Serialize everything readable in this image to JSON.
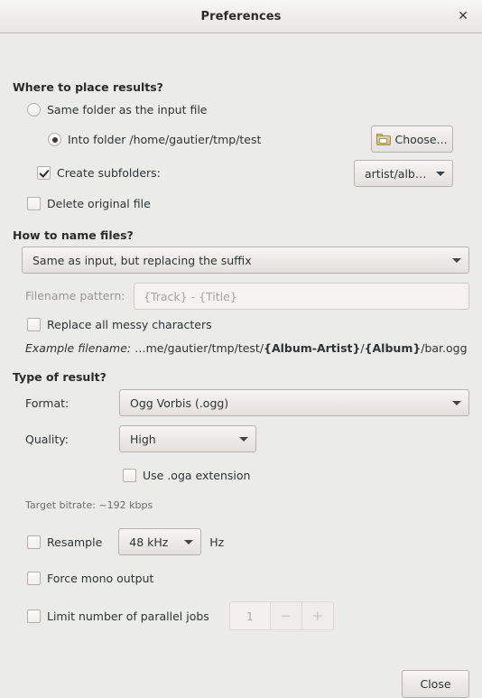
{
  "window": {
    "title": "Preferences",
    "close_icon": "close-icon",
    "close_label": "✕"
  },
  "sections": {
    "where": {
      "heading": "Where to place results?",
      "radio_same_folder": {
        "label": "Same folder as the input file",
        "checked": false
      },
      "radio_into_folder": {
        "label": "Into folder /home/gautier/tmp/test",
        "checked": true
      },
      "choose_button": {
        "label": "Choose...",
        "icon": "folder-icon"
      },
      "create_subfolders": {
        "label": "Create subfolders:",
        "checked": true
      },
      "subfolders_combo": {
        "value": "artist/album"
      },
      "delete_original": {
        "label": "Delete original file",
        "checked": false
      }
    },
    "naming": {
      "heading": "How to name files?",
      "naming_combo": {
        "value": "Same as input, but replacing the suffix"
      },
      "pattern_label": "Filename pattern:",
      "pattern_input": {
        "value": "",
        "placeholder": "{Track} - {Title}"
      },
      "replace_messy": {
        "label": "Replace all messy characters",
        "checked": false
      },
      "example": {
        "lead": "Example filename:",
        "part1": " …me/gautier/tmp/test/",
        "bold1": "{Album-Artist}",
        "sep1": "/",
        "bold2": "{Album}",
        "tail": "/bar.ogg"
      }
    },
    "result": {
      "heading": "Type of result?",
      "format_label": "Format:",
      "format_combo": {
        "value": "Ogg Vorbis (.ogg)"
      },
      "quality_label": "Quality:",
      "quality_combo": {
        "value": "High"
      },
      "use_oga": {
        "label": "Use .oga extension",
        "checked": false
      },
      "target_bitrate": "Target bitrate: ~192 kbps",
      "resample": {
        "label": "Resample",
        "checked": false
      },
      "resample_combo": {
        "value": "48 kHz"
      },
      "resample_unit": "Hz",
      "force_mono": {
        "label": "Force mono output",
        "checked": false
      },
      "limit_jobs": {
        "label": "Limit number of parallel jobs",
        "checked": false
      },
      "jobs_spin": {
        "value": "1",
        "minus": "−",
        "plus": "+"
      }
    }
  },
  "footer": {
    "close_button": "Close"
  },
  "colors": {
    "window_bg": "#ebebe9",
    "titlebar_top": "#f8f8f7",
    "text": "#2e3436",
    "disabled_text": "#9b9894",
    "border": "#b6b2ad",
    "folder_icon": "#cdb87a"
  }
}
